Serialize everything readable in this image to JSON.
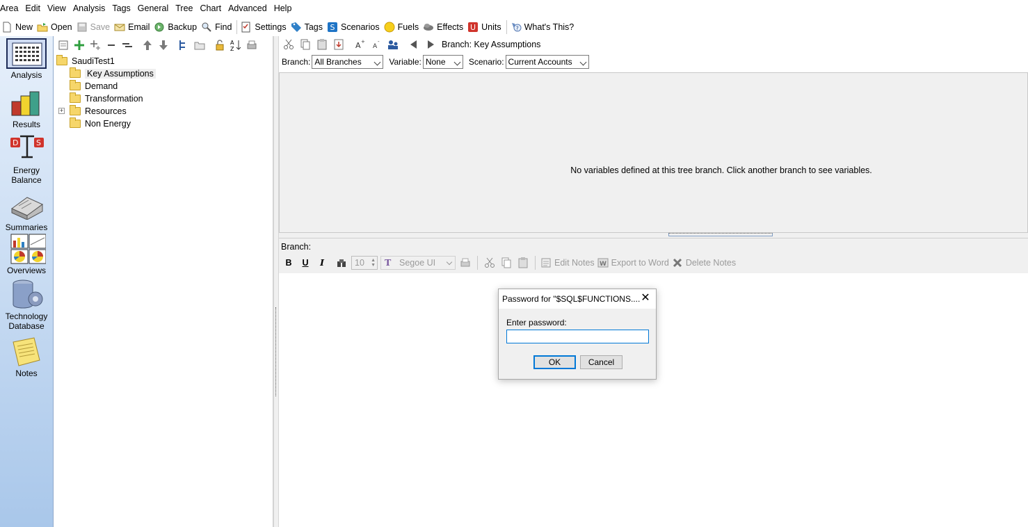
{
  "menu": [
    "Area",
    "Edit",
    "View",
    "Analysis",
    "Tags",
    "General",
    "Tree",
    "Chart",
    "Advanced",
    "Help"
  ],
  "toolbar": [
    {
      "label": "New",
      "icon": "new-icon",
      "enabled": true
    },
    {
      "label": "Open",
      "icon": "open-icon",
      "enabled": true
    },
    {
      "label": "Save",
      "icon": "save-icon",
      "enabled": false
    },
    {
      "label": "Email",
      "icon": "email-icon",
      "enabled": true
    },
    {
      "label": "Backup",
      "icon": "backup-icon",
      "enabled": true
    },
    {
      "label": "Find",
      "icon": "find-icon",
      "enabled": true
    },
    {
      "label": "Settings",
      "icon": "settings-icon",
      "enabled": true
    },
    {
      "label": "Tags",
      "icon": "tag-icon",
      "enabled": true
    },
    {
      "label": "Scenarios",
      "icon": "scenarios-icon",
      "enabled": true
    },
    {
      "label": "Fuels",
      "icon": "fuels-icon",
      "enabled": true
    },
    {
      "label": "Effects",
      "icon": "effects-icon",
      "enabled": true
    },
    {
      "label": "Units",
      "icon": "units-icon",
      "enabled": true
    },
    {
      "label": "What's This?",
      "icon": "help-icon",
      "enabled": true
    }
  ],
  "sidebar": [
    {
      "label": "Analysis",
      "icon": "analysis-icon",
      "active": true
    },
    {
      "label": "Results",
      "icon": "results-icon",
      "active": false
    },
    {
      "label": "Energy Balance",
      "icon": "energy-balance-icon",
      "active": false
    },
    {
      "label": "Summaries",
      "icon": "summaries-icon",
      "active": false
    },
    {
      "label": "Overviews",
      "icon": "overviews-icon",
      "active": false
    },
    {
      "label": "Technology Database",
      "icon": "technology-database-icon",
      "active": false
    },
    {
      "label": "Notes",
      "icon": "notes-icon",
      "active": false
    }
  ],
  "tree": {
    "root": "SaudiTest1",
    "items": [
      {
        "label": "Key Assumptions",
        "selected": true,
        "expandable": false
      },
      {
        "label": "Demand",
        "selected": false,
        "expandable": false
      },
      {
        "label": "Transformation",
        "selected": false,
        "expandable": false
      },
      {
        "label": "Resources",
        "selected": false,
        "expandable": true
      },
      {
        "label": "Non Energy",
        "selected": false,
        "expandable": false
      }
    ]
  },
  "branch_header": "Branch: Key Assumptions",
  "filters": {
    "branch_label": "Branch:",
    "branch_value": "All Branches",
    "variable_label": "Variable:",
    "variable_value": "None",
    "scenario_label": "Scenario:",
    "scenario_value": "Current Accounts"
  },
  "variables_message": "No variables defined at this tree branch. Click another branch to see variables.",
  "notes": {
    "title": "Branch:",
    "font_size": "10",
    "font_name": "Segoe UI",
    "edit_notes": "Edit Notes",
    "export_to_word": "Export to Word",
    "delete_notes": "Delete Notes"
  },
  "dialog": {
    "title": "Password for \"$SQL$FUNCTIONS....",
    "label": "Enter password:",
    "password_value": "",
    "ok": "OK",
    "cancel": "Cancel"
  },
  "colors": {
    "accent": "#0078d7",
    "sidebar_top": "#e7f0fb",
    "sidebar_bottom": "#a9c7ea",
    "folder": "#f6d66a"
  }
}
